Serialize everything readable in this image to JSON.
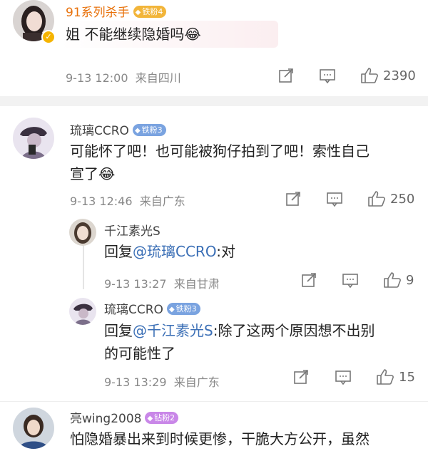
{
  "comments": [
    {
      "user": "91系列杀手",
      "badge": "铁粉4",
      "text": "姐 不能继续隐婚吗",
      "emoji": "😂",
      "time": "9-13 12:00",
      "location": "来自四川",
      "likes": "2390"
    },
    {
      "user": "琉璃CCRO",
      "badge": "铁粉3",
      "text": "可能怀了吧！也可能被狗仔拍到了吧！索性自己",
      "text2": "宣了",
      "emoji": "😂",
      "time": "9-13 12:46",
      "location": "来自广东",
      "likes": "250",
      "replies": [
        {
          "user": "千江素光S",
          "reply_prefix": "回复",
          "mention": "@琉璃CCRO",
          "text": ":对",
          "time": "9-13 13:27",
          "location": "来自甘肃",
          "likes": "9"
        },
        {
          "user": "琉璃CCRO",
          "badge": "铁粉3",
          "reply_prefix": "回复",
          "mention": "@千江素光S",
          "text": ":除了这两个原因想不出别",
          "text2": "的可能性了",
          "time": "9-13 13:29",
          "location": "来自广东",
          "likes": "15"
        }
      ]
    },
    {
      "user": "亮wing2008",
      "badge": "钻粉2",
      "text": "怕隐婚暴出来到时候更惨，干脆大方公开，虽然"
    }
  ],
  "icons": {
    "share": "share-icon",
    "comment": "comment-icon",
    "like": "like-icon"
  }
}
